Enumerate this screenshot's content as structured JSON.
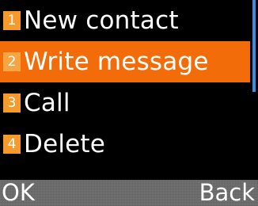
{
  "menu": {
    "items": [
      {
        "number": "1",
        "label": "New contact",
        "selected": false
      },
      {
        "number": "2",
        "label": "Write message",
        "selected": true
      },
      {
        "number": "3",
        "label": "Call",
        "selected": false
      },
      {
        "number": "4",
        "label": "Delete",
        "selected": false
      }
    ]
  },
  "softkeys": {
    "left": "OK",
    "right": "Back"
  },
  "colors": {
    "selection": "#f26c0a",
    "badge": "#f59a2b",
    "scrollbar": "#3a8fe0",
    "softkey_bar": "#6d6d6d"
  }
}
